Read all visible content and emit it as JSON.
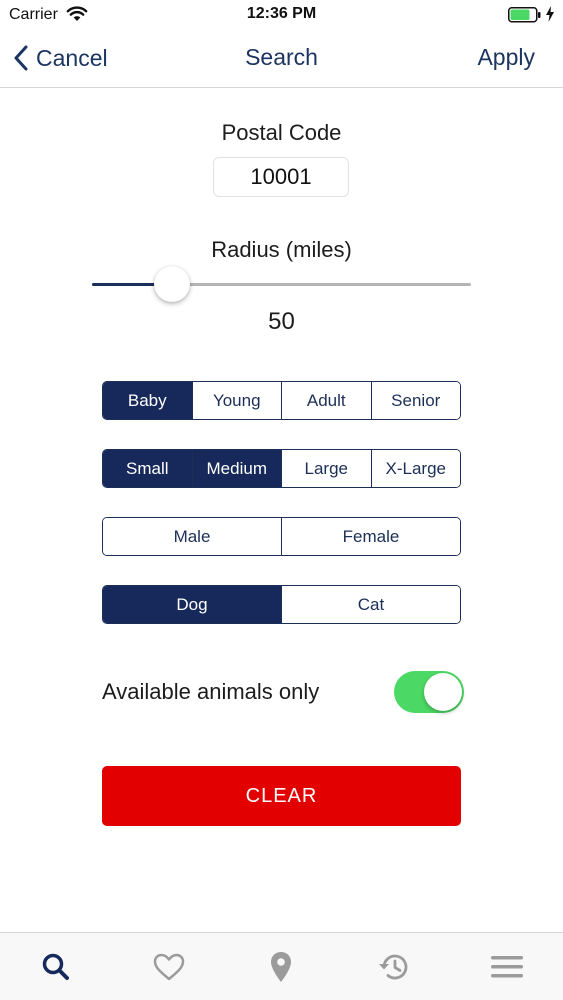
{
  "status_bar": {
    "carrier": "Carrier",
    "time": "12:36 PM",
    "battery_color": "#4cd864"
  },
  "nav": {
    "cancel_label": "Cancel",
    "title": "Search",
    "apply_label": "Apply"
  },
  "postal": {
    "label": "Postal Code",
    "value": "10001"
  },
  "radius": {
    "label": "Radius (miles)",
    "value": "50",
    "slider_fraction": 0.21
  },
  "age_filter": {
    "options": [
      "Baby",
      "Young",
      "Adult",
      "Senior"
    ],
    "selected": [
      "Baby"
    ]
  },
  "size_filter": {
    "options": [
      "Small",
      "Medium",
      "Large",
      "X-Large"
    ],
    "selected": [
      "Small",
      "Medium"
    ]
  },
  "gender_filter": {
    "options": [
      "Male",
      "Female"
    ],
    "selected": []
  },
  "species_filter": {
    "options": [
      "Dog",
      "Cat"
    ],
    "selected": [
      "Dog"
    ]
  },
  "available_only": {
    "label": "Available animals only",
    "on": true
  },
  "clear_label": "CLEAR",
  "colors": {
    "navy": "#16295a",
    "toggle_on": "#4cd864",
    "clear_red": "#e30000"
  },
  "tab_bar": {
    "tabs": [
      {
        "icon": "search-icon",
        "active": true
      },
      {
        "icon": "heart-icon",
        "active": false
      },
      {
        "icon": "location-pin-icon",
        "active": false
      },
      {
        "icon": "history-icon",
        "active": false
      },
      {
        "icon": "menu-icon",
        "active": false
      }
    ]
  }
}
